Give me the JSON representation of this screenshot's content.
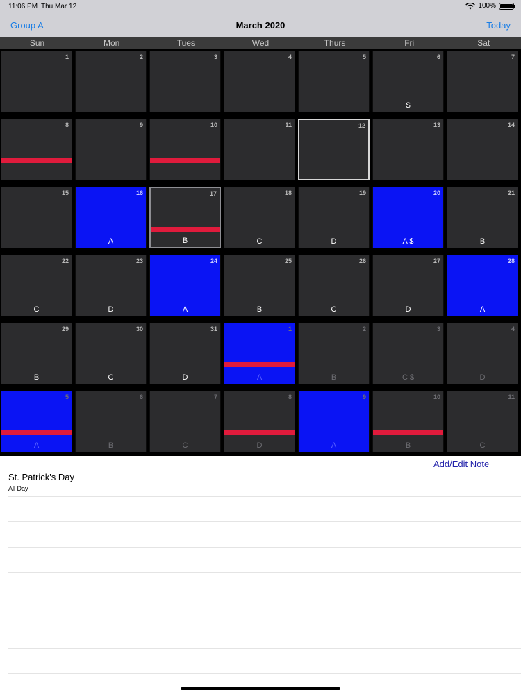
{
  "status_bar": {
    "time": "11:06 PM",
    "date": "Thu Mar 12",
    "battery": "100%"
  },
  "nav": {
    "left_button": "Group A",
    "title": "March 2020",
    "right_button": "Today"
  },
  "weekdays": [
    "Sun",
    "Mon",
    "Tues",
    "Wed",
    "Thurs",
    "Fri",
    "Sat"
  ],
  "weeks": [
    [
      {
        "day": "1",
        "label": ""
      },
      {
        "day": "2",
        "label": ""
      },
      {
        "day": "3",
        "label": ""
      },
      {
        "day": "4",
        "label": ""
      },
      {
        "day": "5",
        "label": ""
      },
      {
        "day": "6",
        "label": "$"
      },
      {
        "day": "7",
        "label": ""
      }
    ],
    [
      {
        "day": "8",
        "label": "",
        "bar": true
      },
      {
        "day": "9",
        "label": ""
      },
      {
        "day": "10",
        "label": "",
        "bar": true
      },
      {
        "day": "11",
        "label": ""
      },
      {
        "day": "12",
        "label": "",
        "today": true
      },
      {
        "day": "13",
        "label": ""
      },
      {
        "day": "14",
        "label": ""
      }
    ],
    [
      {
        "day": "15",
        "label": ""
      },
      {
        "day": "16",
        "label": "A",
        "blue": true
      },
      {
        "day": "17",
        "label": "B",
        "bar": true,
        "selected": true
      },
      {
        "day": "18",
        "label": "C"
      },
      {
        "day": "19",
        "label": "D"
      },
      {
        "day": "20",
        "label": "A $",
        "blue": true
      },
      {
        "day": "21",
        "label": "B"
      }
    ],
    [
      {
        "day": "22",
        "label": "C"
      },
      {
        "day": "23",
        "label": "D"
      },
      {
        "day": "24",
        "label": "A",
        "blue": true
      },
      {
        "day": "25",
        "label": "B"
      },
      {
        "day": "26",
        "label": "C"
      },
      {
        "day": "27",
        "label": "D"
      },
      {
        "day": "28",
        "label": "A",
        "blue": true
      }
    ],
    [
      {
        "day": "29",
        "label": "B"
      },
      {
        "day": "30",
        "label": "C"
      },
      {
        "day": "31",
        "label": "D"
      },
      {
        "day": "1",
        "label": "A",
        "blue": true,
        "bar": true,
        "dim": true
      },
      {
        "day": "2",
        "label": "B",
        "dim": true
      },
      {
        "day": "3",
        "label": "C $",
        "dim": true
      },
      {
        "day": "4",
        "label": "D",
        "dim": true
      }
    ],
    [
      {
        "day": "5",
        "label": "A",
        "blue": true,
        "bar": true,
        "dim": true
      },
      {
        "day": "6",
        "label": "B",
        "dim": true
      },
      {
        "day": "7",
        "label": "C",
        "dim": true
      },
      {
        "day": "8",
        "label": "D",
        "bar": true,
        "dim": true
      },
      {
        "day": "9",
        "label": "A",
        "blue": true,
        "dim": true
      },
      {
        "day": "10",
        "label": "B",
        "bar": true,
        "dim": true
      },
      {
        "day": "11",
        "label": "C",
        "dim": true
      }
    ]
  ],
  "notes": {
    "add_edit_label": "Add/Edit Note",
    "event_title": "St. Patrick's Day",
    "event_subtitle": "All Day"
  },
  "colors": {
    "accent": "#1a7ee6",
    "highlight_day": "#0a14f4",
    "event_bar": "#e01b3c",
    "cell_bg": "#2c2c2e"
  }
}
